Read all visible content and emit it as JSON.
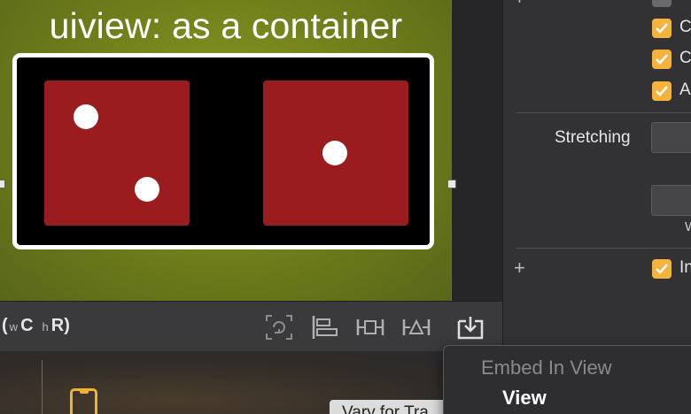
{
  "canvas": {
    "scene_title": "uiview: as a container",
    "container_view": {
      "dice": [
        {
          "name": "die-two",
          "pips": 2,
          "color": "#9b1c1f"
        },
        {
          "name": "die-one",
          "pips": 1,
          "color": "#9b1c1f"
        }
      ]
    },
    "background_color": "#7a8a1e"
  },
  "toolbar": {
    "size_class": {
      "width_prefix": "w",
      "width_value": "C",
      "height_prefix": "h",
      "height_value": "R",
      "open": "(",
      "close": ")"
    },
    "icons": [
      "update-frames-icon",
      "align-icon",
      "add-constraints-icon",
      "resolve-issues-icon",
      "embed-in-icon"
    ]
  },
  "inspector": {
    "checkboxes": [
      {
        "label": "C",
        "checked": true
      },
      {
        "label": "C",
        "checked": true
      },
      {
        "label": "A",
        "checked": true
      },
      {
        "label": "In",
        "checked": true
      }
    ],
    "stretching_label": "Stretching",
    "cut_label_w": "W",
    "accent_color": "#f5b33c"
  },
  "outline": {
    "vary_button_label": "Vary for Tra"
  },
  "embed_menu": {
    "heading": "Embed In View",
    "items": [
      "View"
    ]
  }
}
